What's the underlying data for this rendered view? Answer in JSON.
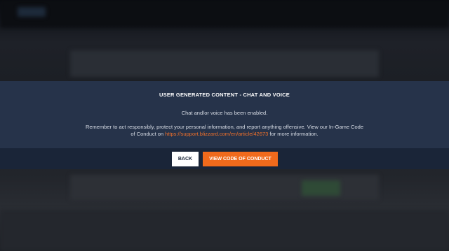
{
  "dialog": {
    "title": "USER GENERATED CONTENT - CHAT AND VOICE",
    "subtitle": "Chat and/or voice has been enabled.",
    "body_line1": "Remember to act responsibly, protect your personal information, and report anything offensive. View our In-Game Code of Conduct on ",
    "link_text": "https://support.blizzard.com/en/article/42673",
    "body_suffix": " for more information."
  },
  "buttons": {
    "back_label": "BACK",
    "conduct_label": "VIEW CODE OF CONDUCT"
  },
  "colors": {
    "accent": "#f06a1c",
    "modal_bg": "#26334a",
    "footer_bg": "#1a2538"
  }
}
